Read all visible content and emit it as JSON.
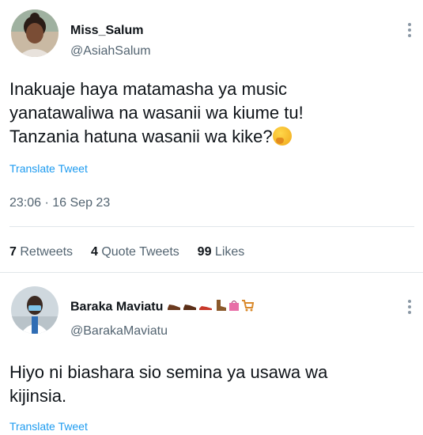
{
  "tweet": {
    "author_name": "Miss_Salum",
    "author_handle": "@AsiahSalum",
    "text_line1": "Inakuaje haya matamasha ya music",
    "text_line2": "yanatawaliwa na wasanii wa kiume tu!",
    "text_line3": "Tanzania hatuna wasanii wa kike?",
    "translate_label": "Translate Tweet",
    "timestamp": "23:06 · 16 Sep 23",
    "retweets_count": "7",
    "retweets_label": "Retweets",
    "quotes_count": "4",
    "quotes_label": "Quote Tweets",
    "likes_count": "99",
    "likes_label": "Likes"
  },
  "reply": {
    "author_name": "Baraka Maviatu",
    "author_handle": "@BarakaMaviatu",
    "text_line1": "Hiyo ni biashara sio semina ya usawa wa",
    "text_line2": "kijinsia.",
    "translate_label": "Translate Tweet",
    "name_emojis": [
      "shoe-icon",
      "shoe-icon",
      "shoe-icon",
      "boot-icon",
      "shopping-bag-icon",
      "shopping-cart-icon"
    ]
  },
  "colors": {
    "link": "#1d9bf0",
    "muted": "#536471",
    "text": "#0f1419"
  }
}
